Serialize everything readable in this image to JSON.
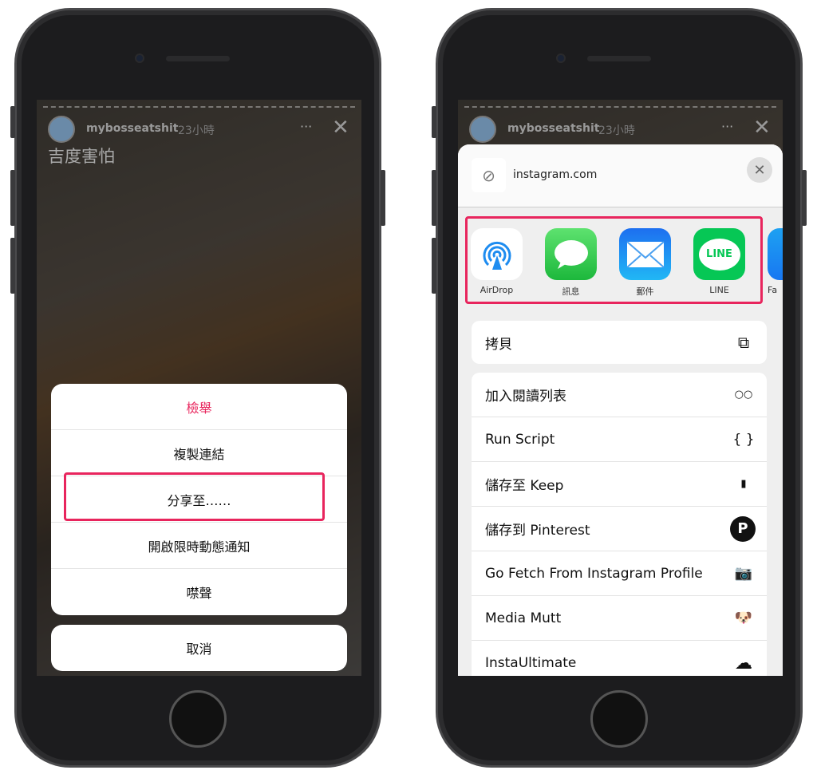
{
  "left": {
    "story": {
      "username": "mybosseatshit",
      "time": "23小時",
      "more": "···",
      "close": "✕",
      "caption": "吉度害怕"
    },
    "menu": [
      "檢舉",
      "複製連結",
      "分享至……",
      "開啟限時動態通知",
      "噤聲"
    ],
    "cancel": "取消",
    "report_color": "#e8255d"
  },
  "right": {
    "story": {
      "username": "mybosseatshit",
      "time": "23小時",
      "more": "···",
      "close": "✕"
    },
    "sheet": {
      "site": "instagram.com",
      "close": "✕",
      "apps": [
        {
          "label": "AirDrop",
          "icon": "airdrop-icon",
          "color": "#ffffff"
        },
        {
          "label": "訊息",
          "icon": "messages-icon",
          "color": "#34c759"
        },
        {
          "label": "郵件",
          "icon": "mail-icon",
          "color": "#1e8cf0"
        },
        {
          "label": "LINE",
          "icon": "line-icon",
          "color": "#06c755",
          "icon_text": "LINE"
        },
        {
          "label": "Fa",
          "icon": "facebook-icon",
          "color": "#1877f2"
        }
      ],
      "copy": {
        "label": "拷貝",
        "icon": "copy-icon"
      },
      "actions": [
        {
          "label": "加入閱讀列表",
          "icon": "glasses-icon",
          "glyph": "○○"
        },
        {
          "label": "Run Script",
          "icon": "braces-icon",
          "glyph": "{ }"
        },
        {
          "label": "儲存至 Keep",
          "icon": "bookmark-icon",
          "glyph": "▮"
        },
        {
          "label": "儲存到 Pinterest",
          "icon": "pinterest-icon",
          "glyph": "P"
        },
        {
          "label": "Go Fetch From Instagram Profile",
          "icon": "camera-icon",
          "glyph": "📷"
        },
        {
          "label": "Media Mutt",
          "icon": "dog-icon",
          "glyph": "🐶"
        },
        {
          "label": "InstaUltimate",
          "icon": "cloud-icon",
          "glyph": "☁"
        }
      ]
    }
  },
  "highlight_color": "#e8255d"
}
